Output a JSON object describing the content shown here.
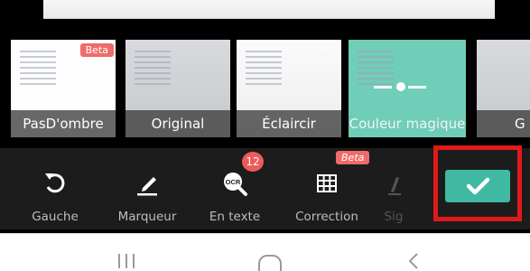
{
  "filters": [
    {
      "label": "PasD'ombre",
      "badge": "Beta"
    },
    {
      "label": "Original"
    },
    {
      "label": "Éclaircir"
    },
    {
      "label": "Couleur magique",
      "selected": true
    },
    {
      "label": "G"
    }
  ],
  "toolbar": {
    "tools": [
      {
        "label": "Gauche",
        "icon": "rotate-left-icon"
      },
      {
        "label": "Marqueur",
        "icon": "marker-icon"
      },
      {
        "label": "En texte",
        "icon": "ocr-icon",
        "badge_count": "12"
      },
      {
        "label": "Correction",
        "icon": "grid-correction-icon",
        "badge": "Beta"
      },
      {
        "label": "Sig",
        "icon": "signature-icon"
      }
    ],
    "confirm_icon": "checkmark-icon"
  },
  "navbar": {
    "recent_icon": "recent-apps-icon",
    "home_icon": "home-icon",
    "back_icon": "back-icon"
  },
  "colors": {
    "accent": "#3fb9a2",
    "highlight": "#e01a1a",
    "beta": "#f06b6b"
  }
}
